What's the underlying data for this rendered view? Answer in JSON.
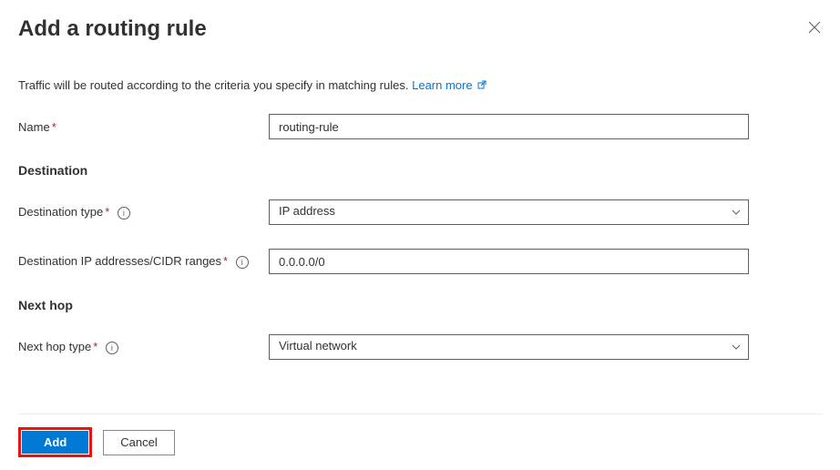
{
  "title": "Add a routing rule",
  "description": "Traffic will be routed according to the criteria you specify in matching rules.",
  "learn_more": "Learn more",
  "fields": {
    "name": {
      "label": "Name",
      "value": "routing-rule"
    },
    "destination_type": {
      "label": "Destination type",
      "value": "IP address"
    },
    "destination_ip": {
      "label": "Destination IP addresses/CIDR ranges",
      "value": "0.0.0.0/0"
    },
    "next_hop_type": {
      "label": "Next hop type",
      "value": "Virtual network"
    }
  },
  "sections": {
    "destination": "Destination",
    "next_hop": "Next hop"
  },
  "actions": {
    "add": "Add",
    "cancel": "Cancel"
  }
}
